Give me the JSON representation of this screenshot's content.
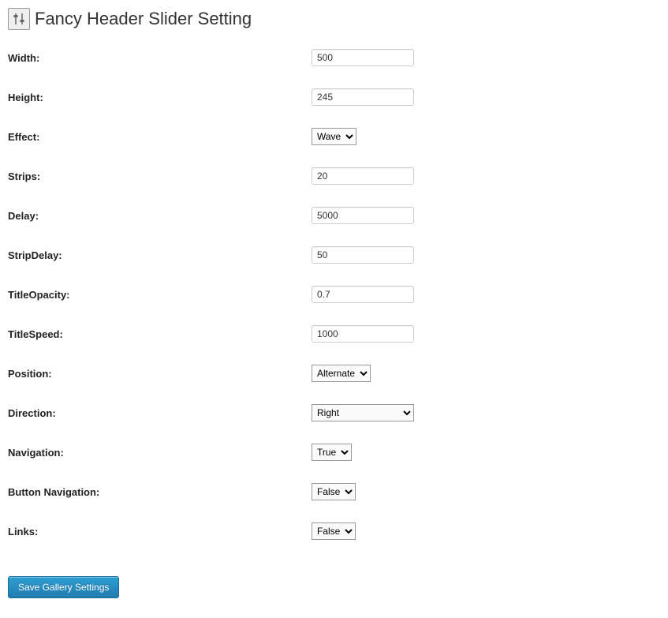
{
  "header": {
    "title": "Fancy Header Slider Setting"
  },
  "fields": {
    "width": {
      "label": "Width:",
      "type": "text",
      "value": "500"
    },
    "height": {
      "label": "Height:",
      "type": "text",
      "value": "245"
    },
    "effect": {
      "label": "Effect:",
      "type": "select",
      "value": "Wave"
    },
    "strips": {
      "label": "Strips:",
      "type": "text",
      "value": "20"
    },
    "delay": {
      "label": "Delay:",
      "type": "text",
      "value": "5000"
    },
    "stripDelay": {
      "label": "StripDelay:",
      "type": "text",
      "value": "50"
    },
    "titleOpacity": {
      "label": "TitleOpacity:",
      "type": "text",
      "value": "0.7"
    },
    "titleSpeed": {
      "label": "TitleSpeed:",
      "type": "text",
      "value": "1000"
    },
    "position": {
      "label": "Position:",
      "type": "select",
      "value": "Alternate"
    },
    "direction": {
      "label": "Direction:",
      "type": "select",
      "value": "Right",
      "wide": true
    },
    "navigation": {
      "label": "Navigation:",
      "type": "select",
      "value": "True"
    },
    "buttonNavigation": {
      "label": "Button Navigation:",
      "type": "select",
      "value": "False"
    },
    "links": {
      "label": "Links:",
      "type": "select",
      "value": "False"
    }
  },
  "actions": {
    "save_label": "Save Gallery Settings"
  }
}
